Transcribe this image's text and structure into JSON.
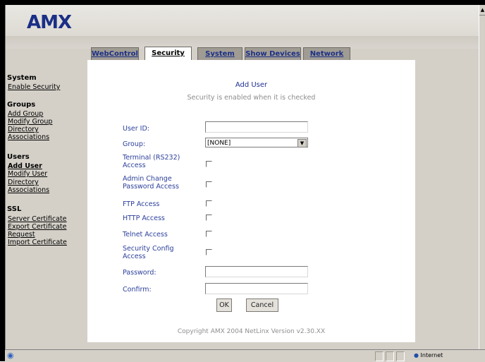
{
  "header": {
    "logo": "AMX"
  },
  "nav": {
    "system": {
      "title": "System",
      "items": [
        "Enable Security"
      ]
    },
    "groups": {
      "title": "Groups",
      "items": [
        "Add Group",
        "Modify Group",
        "Directory",
        "Associations"
      ]
    },
    "users": {
      "title": "Users",
      "items": [
        "Add User",
        "Modify User",
        "Directory",
        "Associations"
      ]
    },
    "ssl": {
      "title": "SSL",
      "items": [
        "Server Certificate",
        "Export Certificate",
        "Request",
        "Import Certificate"
      ]
    }
  },
  "tabs": [
    "WebControl",
    "Security",
    "System",
    "Show Devices",
    "Network"
  ],
  "form": {
    "title": "Add User",
    "subtitle": "Security is enabled when it is checked",
    "user_id_label": "User ID:",
    "user_id_value": "",
    "group_label": "Group:",
    "group_value": "[NONE]",
    "terminal_label_1": "Terminal (RS232)",
    "terminal_label_2": "Access",
    "admin_label_1": "Admin Change",
    "admin_label_2": "Password Access",
    "ftp_label": "FTP Access",
    "http_label": "HTTP Access",
    "telnet_label": "Telnet Access",
    "secconfig_label_1": "Security Config",
    "secconfig_label_2": "Access",
    "password_label": "Password:",
    "confirm_label": "Confirm:",
    "ok_label": "OK",
    "cancel_label": "Cancel",
    "copyright": "Copyright AMX 2004   NetLinx Version v2.30.XX"
  },
  "status": {
    "zone": "Internet"
  },
  "icons": {
    "scroll_up": "scroll-up-icon",
    "ie_page": "ie-page-icon",
    "globe": "internet-zone-icon"
  }
}
